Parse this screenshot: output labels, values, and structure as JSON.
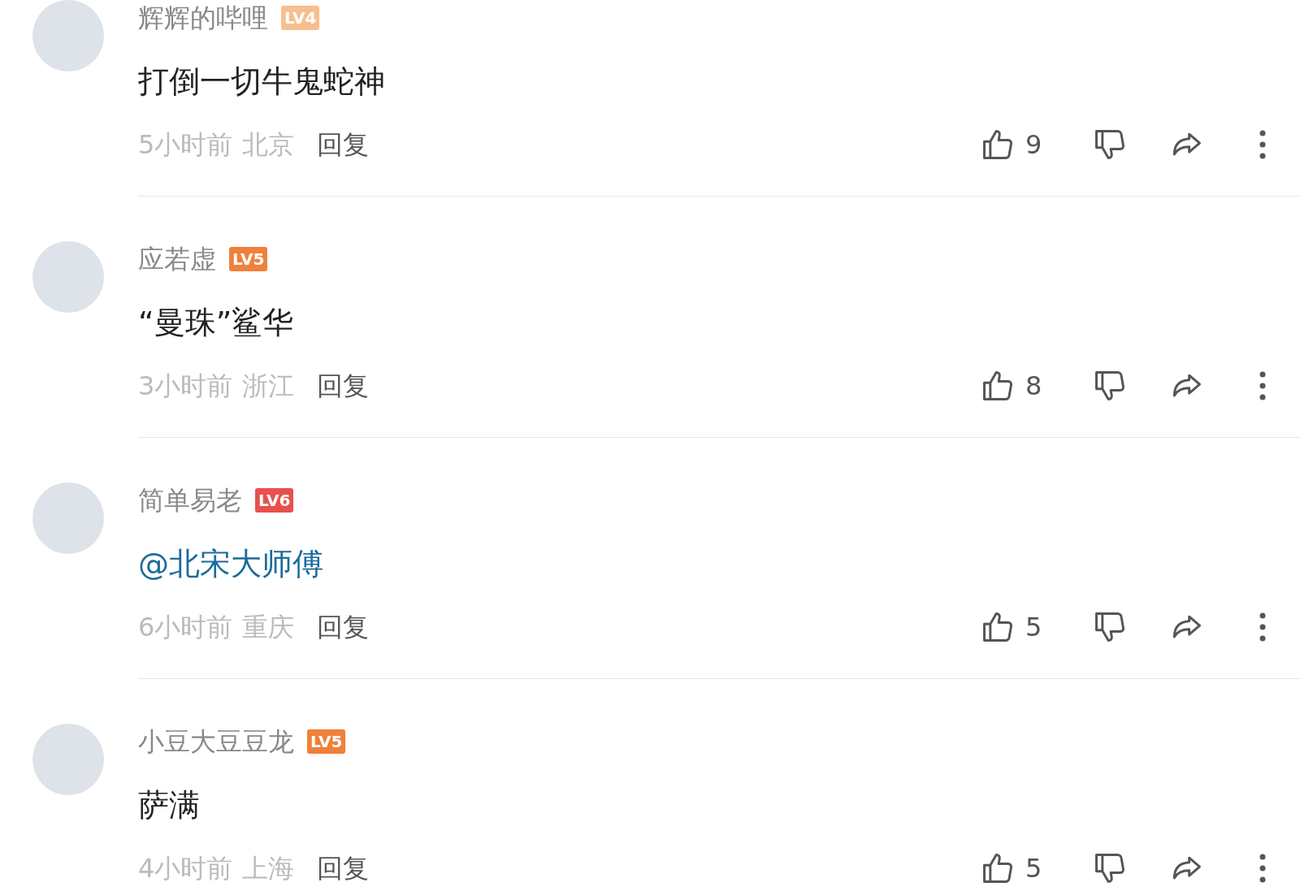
{
  "comments": [
    {
      "user": "辉辉的哔哩",
      "badge": {
        "text": "LV4",
        "color": "#f7bf8f"
      },
      "content": {
        "text": "打倒一切牛鬼蛇神",
        "kind": "text"
      },
      "time": "5小时前",
      "location": "北京",
      "reply": "回复",
      "likes": "9"
    },
    {
      "user": "应若虚",
      "badge": {
        "text": "LV5",
        "color": "#f0803a"
      },
      "content": {
        "text": "“曼珠”鲨华",
        "kind": "text"
      },
      "time": "3小时前",
      "location": "浙江",
      "reply": "回复",
      "likes": "8"
    },
    {
      "user": "简单易老",
      "badge": {
        "text": "LV6",
        "color": "#e8504b"
      },
      "content": {
        "text": "@北宋大师傅",
        "kind": "mention"
      },
      "time": "6小时前",
      "location": "重庆",
      "reply": "回复",
      "likes": "5"
    },
    {
      "user": "小豆大豆豆龙",
      "badge": {
        "text": "LV5",
        "color": "#f0803a"
      },
      "content": {
        "text": "萨满",
        "kind": "text"
      },
      "time": "4小时前",
      "location": "上海",
      "reply": "回复",
      "likes": "5"
    }
  ]
}
